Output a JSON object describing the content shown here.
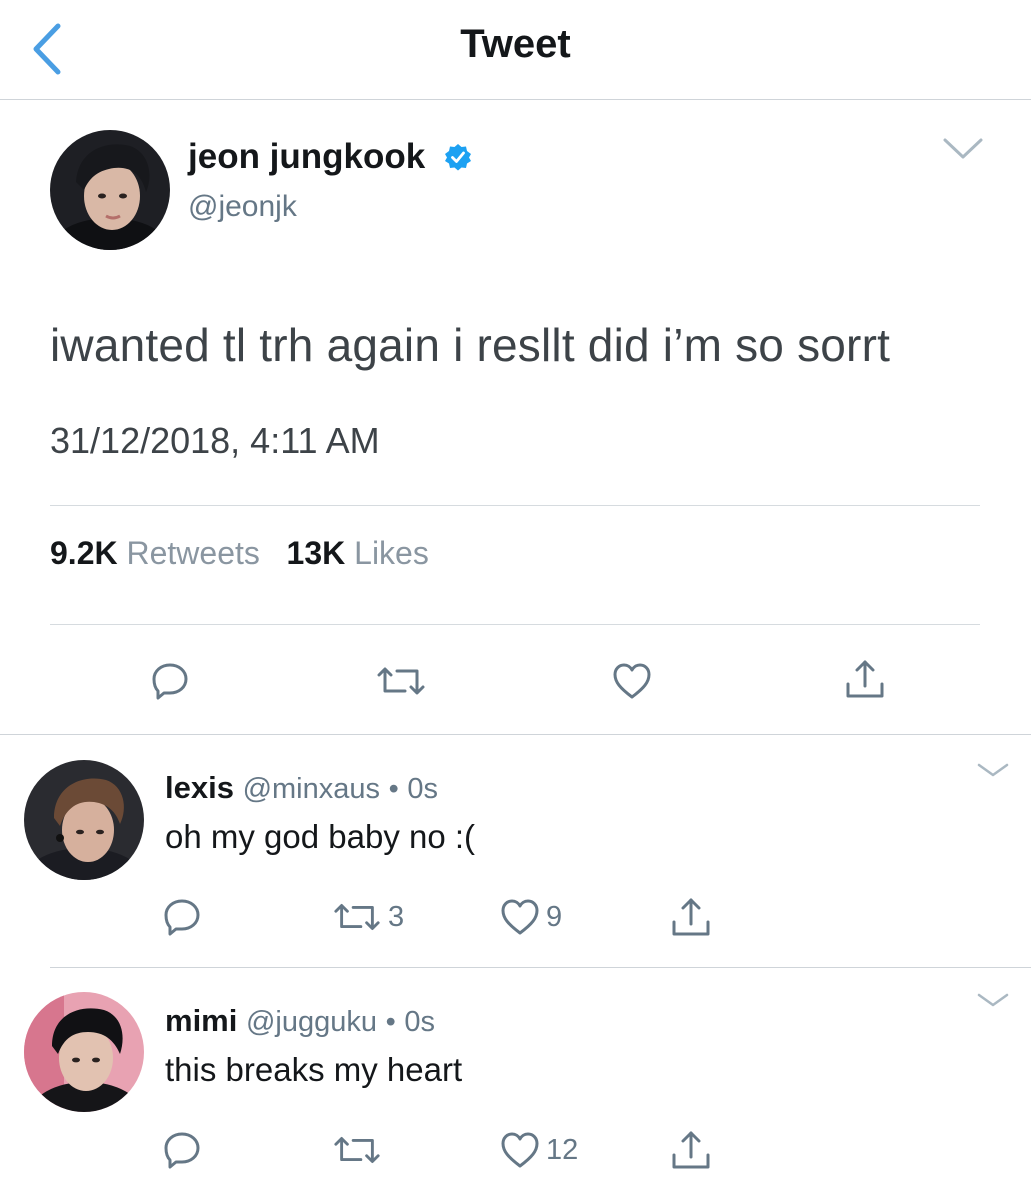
{
  "nav": {
    "title": "Tweet",
    "back_icon": "chevron-left-icon"
  },
  "colors": {
    "accent": "#4a9ee3",
    "verified": "#1da1f2",
    "text": "#14171a",
    "secondary": "#657786",
    "divider": "#cfd4d9"
  },
  "tweet": {
    "name": "jeon jungkook",
    "verified": true,
    "handle": "@jeonjk",
    "text": "iwanted tl trh again i resllt did i’m so sorrt",
    "timestamp": "31/12/2018, 4:11 AM",
    "retweets_count": "9.2K",
    "retweets_label": "Retweets",
    "likes_count": "13K",
    "likes_label": "Likes"
  },
  "replies": [
    {
      "name": "lexis",
      "handle": "@minxaus",
      "sep": "•",
      "time": "0s",
      "text": "oh my god baby no :(",
      "retweets": "3",
      "likes": "9"
    },
    {
      "name": "mimi",
      "handle": "@jugguku",
      "sep": "•",
      "time": "0s",
      "text": "this breaks my heart",
      "retweets": "",
      "likes": "12"
    }
  ]
}
